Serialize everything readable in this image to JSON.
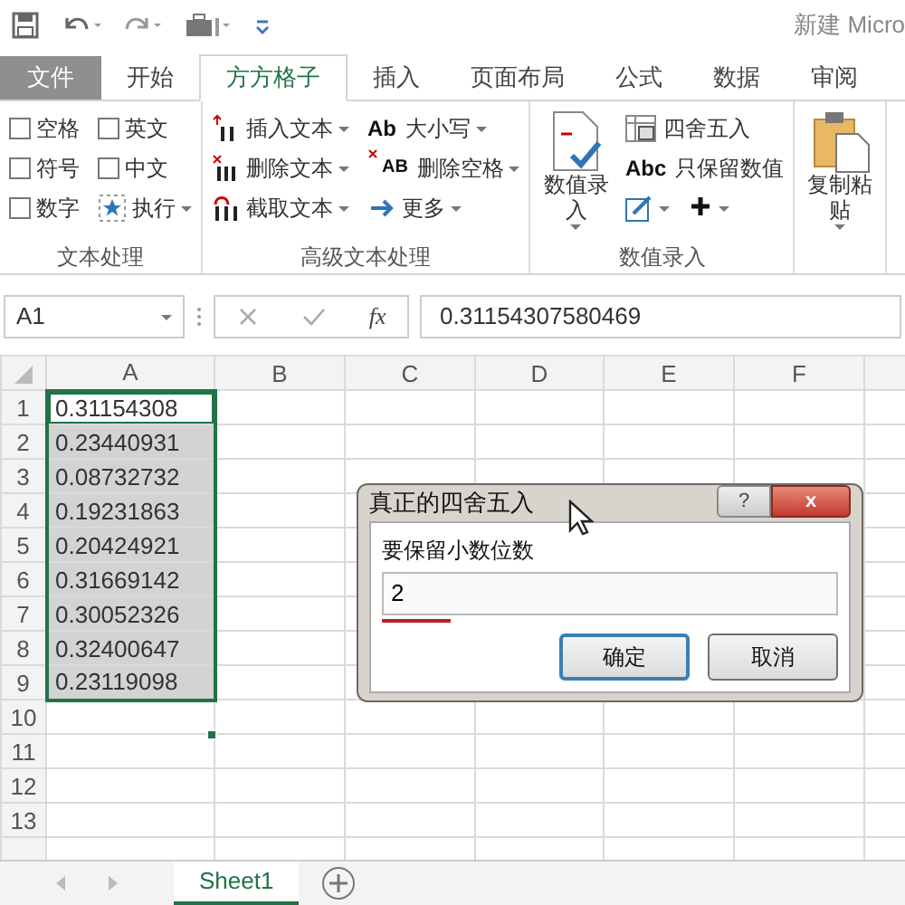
{
  "quick_access": {
    "title": "新建 Micro"
  },
  "tabs": [
    {
      "label": "文件",
      "kind": "file",
      "selected": false
    },
    {
      "label": "开始",
      "kind": "tab",
      "selected": false
    },
    {
      "label": "方方格子",
      "kind": "tab",
      "selected": true
    },
    {
      "label": "插入",
      "kind": "tab",
      "selected": false
    },
    {
      "label": "页面布局",
      "kind": "tab",
      "selected": false
    },
    {
      "label": "公式",
      "kind": "tab",
      "selected": false
    },
    {
      "label": "数据",
      "kind": "tab",
      "selected": false
    },
    {
      "label": "审阅",
      "kind": "tab",
      "selected": false
    }
  ],
  "ribbon": {
    "groups": [
      {
        "label": "文本处理",
        "items": [
          {
            "kind": "checkbox",
            "label": "空格",
            "checked": false
          },
          {
            "kind": "checkbox",
            "label": "符号",
            "checked": false
          },
          {
            "kind": "checkbox",
            "label": "数字",
            "checked": false
          },
          {
            "kind": "checkbox",
            "label": "英文",
            "checked": false
          },
          {
            "kind": "checkbox",
            "label": "中文",
            "checked": false
          },
          {
            "kind": "menu",
            "label": "执行"
          }
        ]
      },
      {
        "label": "高级文本处理",
        "items": [
          {
            "kind": "menu",
            "label": "插入文本"
          },
          {
            "kind": "menu",
            "label": "删除文本"
          },
          {
            "kind": "menu",
            "label": "截取文本"
          },
          {
            "kind": "menu",
            "label": "大小写",
            "icon_text": "Ab"
          },
          {
            "kind": "menu",
            "label": "删除空格",
            "icon_text": "AB"
          },
          {
            "kind": "menu",
            "label": "更多"
          }
        ]
      },
      {
        "label": "数值录入",
        "items": [
          {
            "kind": "large",
            "label": "数值录入"
          },
          {
            "kind": "button",
            "label": "四舍五入"
          },
          {
            "kind": "button",
            "label": "只保留数值",
            "icon_text": "Abc"
          },
          {
            "kind": "iconmenu"
          },
          {
            "kind": "iconmenu"
          }
        ]
      },
      {
        "items": [
          {
            "kind": "large",
            "label": "复制粘贴"
          }
        ]
      }
    ]
  },
  "formula_bar": {
    "name_box": "A1",
    "function": "fx",
    "formula": "0.31154307580469"
  },
  "sheet": {
    "columns": [
      "A",
      "B",
      "C",
      "D",
      "E",
      "F"
    ],
    "rows": [
      {
        "label": "1",
        "value": "0.31154308",
        "selected": true,
        "active": true
      },
      {
        "label": "2",
        "value": "0.23440931",
        "selected": true,
        "active": false
      },
      {
        "label": "3",
        "value": "0.08732732",
        "selected": true,
        "active": false
      },
      {
        "label": "4",
        "value": "0.19231863",
        "selected": true,
        "active": false
      },
      {
        "label": "5",
        "value": "0.20424921",
        "selected": true,
        "active": false
      },
      {
        "label": "6",
        "value": "0.31669142",
        "selected": true,
        "active": false
      },
      {
        "label": "7",
        "value": "0.30052326",
        "selected": true,
        "active": false
      },
      {
        "label": "8",
        "value": "0.32400647",
        "selected": true,
        "active": false
      },
      {
        "label": "9",
        "value": "0.23119098",
        "selected": true,
        "active": false
      },
      {
        "label": "10",
        "selected": false,
        "active": false
      },
      {
        "label": "11",
        "selected": false,
        "active": false
      },
      {
        "label": "12",
        "selected": false,
        "active": false
      },
      {
        "label": "13",
        "selected": false,
        "active": false
      }
    ]
  },
  "dialog": {
    "title": "真正的四舍五入",
    "help": "?",
    "close": "x",
    "label": "要保留小数位数",
    "value": "2",
    "buttons": [
      {
        "label": "确定",
        "default": true
      },
      {
        "label": "取消",
        "default": false
      }
    ]
  },
  "sheet_tabs": [
    {
      "label": "Sheet1",
      "selected": true
    }
  ]
}
